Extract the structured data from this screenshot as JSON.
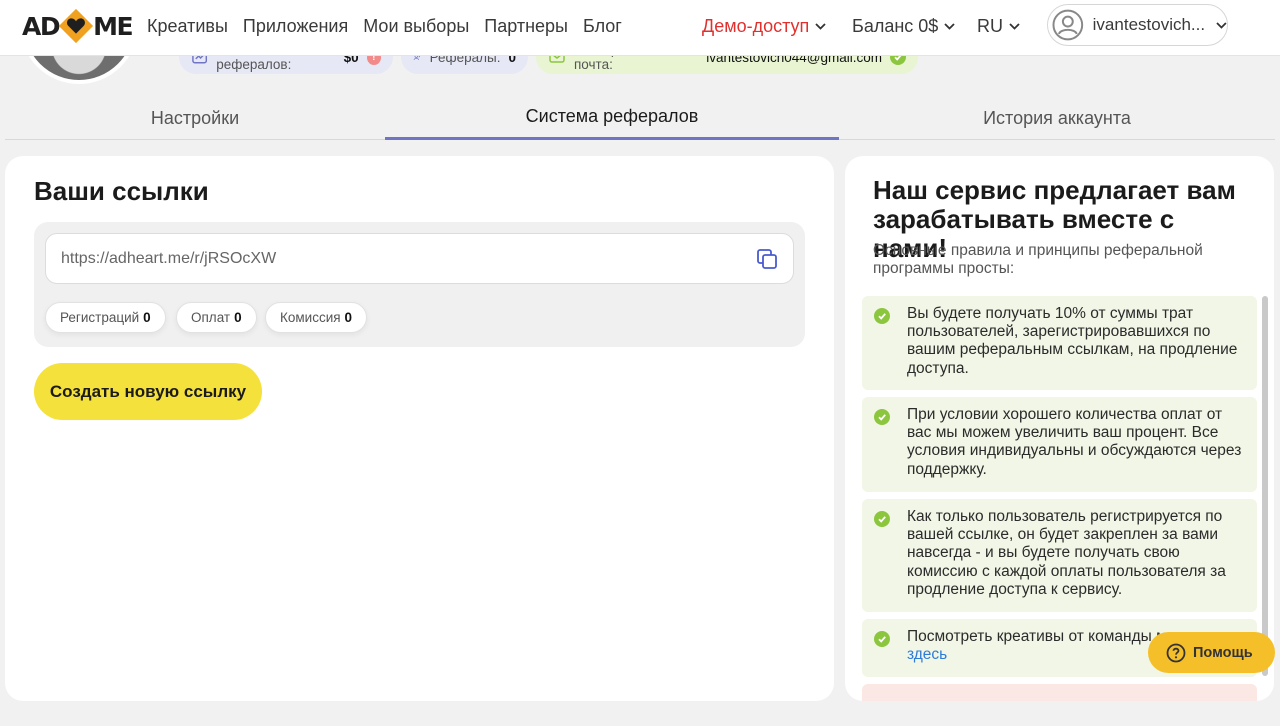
{
  "header": {
    "logo_left": "AD",
    "logo_right": "ME",
    "nav": [
      "Креативы",
      "Приложения",
      "Мои выборы",
      "Партнеры",
      "Блог"
    ],
    "demo_label": "Демо-доступ",
    "balance_label": "Баланс 0$",
    "lang_label": "RU",
    "user_name": "ivantestovich...",
    "accent_color": "#e2302e"
  },
  "profile": {
    "referral_balance_label": "Баланс рефералов:",
    "referral_balance_value": "$0",
    "referral_balance_badge": "!",
    "referrals_label": "Рефералы:",
    "referrals_value": "0",
    "email_label": "Электронная почта:",
    "email_value": "ivantestovich044@gmail.com"
  },
  "tabs": [
    {
      "label": "Настройки",
      "active": false
    },
    {
      "label": "Система рефералов",
      "active": true
    },
    {
      "label": "История аккаунта",
      "active": false
    }
  ],
  "links_card": {
    "title": "Ваши ссылки",
    "link_url": "https://adheart.me/r/jRSOcXW",
    "stats": [
      {
        "label": "Регистраций",
        "value": "0"
      },
      {
        "label": "Оплат",
        "value": "0"
      },
      {
        "label": "Комиссия",
        "value": "0"
      }
    ],
    "create_button": "Создать новую ссылку",
    "button_color": "#f5e13c"
  },
  "info_card": {
    "title": "Наш сервис предлагает вам зарабатывать вместе с нами!",
    "intro": "Основные правила и принципы реферальной программы просты:",
    "rules": [
      "Вы будете получать 10% от суммы трат пользователей, зарегистрировавшихся по вашим реферальным ссылкам, на продление доступа.",
      "При условии хорошего количества оплат от вас мы можем увеличить ваш процент. Все условия индивидуальны и обсуждаются через поддержку.",
      "Как только пользователь регистрируется по вашей ссылке, он будет закреплен за вами навсегда - и вы будете получать свою комиссию с каждой оплаты пользователя за продление доступа к сервису."
    ],
    "rule4_text": "Посмотреть креативы от команды можно",
    "rule4_link": "здесь"
  },
  "help_button": "Помощь"
}
